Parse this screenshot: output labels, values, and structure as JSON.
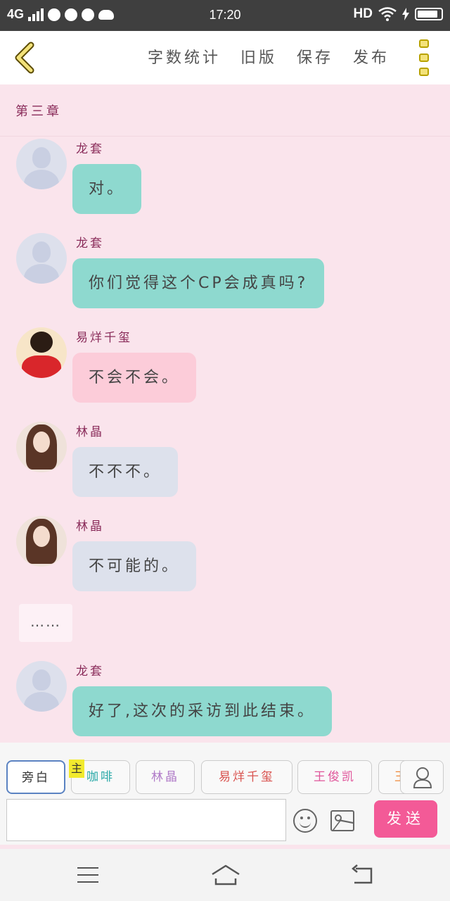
{
  "statusbar": {
    "network": "4G",
    "time": "17:20",
    "hd": "HD"
  },
  "toolbar": {
    "items": [
      "字数统计",
      "旧版",
      "保存",
      "发布"
    ]
  },
  "chapter": {
    "title": "第三章"
  },
  "messages": [
    {
      "name": "龙套",
      "text": "对。",
      "avatar": "default-avatar",
      "color": "#8ed9cf"
    },
    {
      "name": "龙套",
      "text": "你们觉得这个CP会成真吗?",
      "avatar": "default-avatar",
      "color": "#8ed9cf"
    },
    {
      "name": "易烊千玺",
      "text": "不会不会。",
      "avatar": "boy-avatar",
      "color": "#fcccd9"
    },
    {
      "name": "林晶",
      "text": "不不不。",
      "avatar": "girl-avatar",
      "color": "#dde1ec"
    },
    {
      "name": "林晶",
      "text": "不可能的。",
      "avatar": "girl-avatar",
      "color": "#dde1ec"
    },
    {
      "name": "龙套",
      "text": "好了,这次的采访到此结束。",
      "avatar": "default-avatar",
      "color": "#8ed9cf"
    }
  ],
  "narration": {
    "text": "……"
  },
  "roles": {
    "main_tag": "主",
    "chips": [
      {
        "label": "旁白",
        "color": "#333333"
      },
      {
        "label": "咖啡",
        "color": "#2aa9a8"
      },
      {
        "label": "林晶",
        "color": "#b07ac8"
      },
      {
        "label": "易烊千玺",
        "color": "#d9534f"
      },
      {
        "label": "王俊凯",
        "color": "#e0559a"
      },
      {
        "label": "王",
        "color": "#f08a3c"
      }
    ]
  },
  "composer": {
    "send_label": "发送",
    "placeholder": ""
  }
}
